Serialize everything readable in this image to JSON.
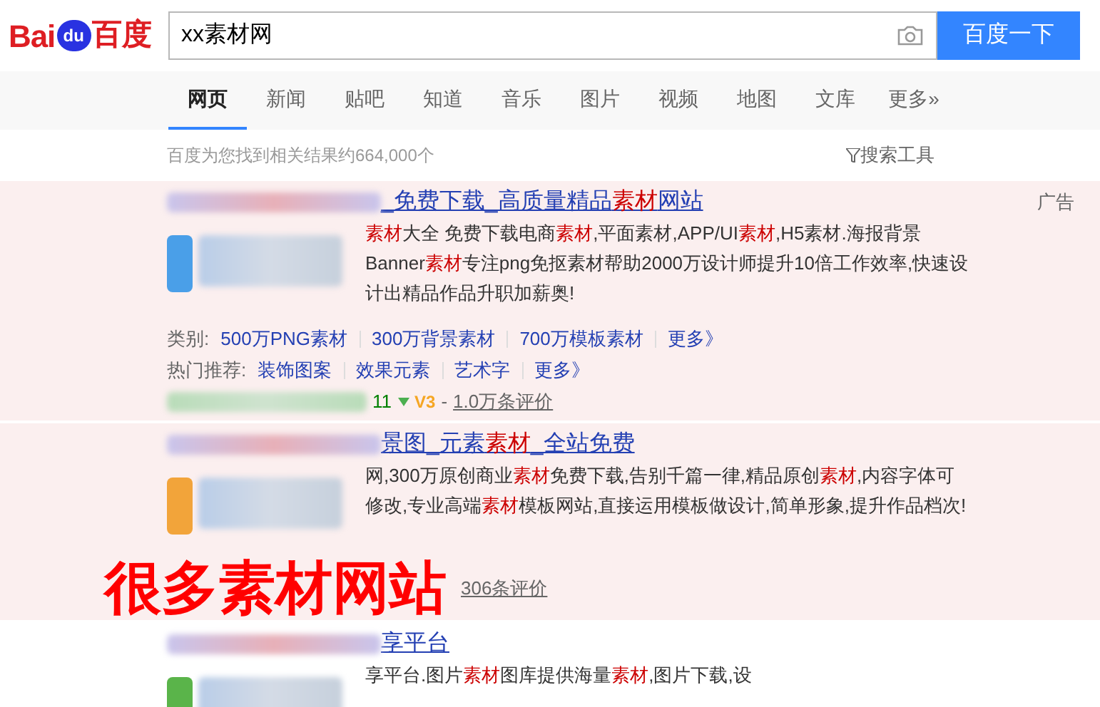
{
  "logo": {
    "part_1": "Bai",
    "part_2": "du",
    "part_3": "百度"
  },
  "search": {
    "value": "xx素材网",
    "button": "百度一下"
  },
  "tabs": [
    {
      "label": "网页",
      "selected": true
    },
    {
      "label": "新闻",
      "selected": false
    },
    {
      "label": "贴吧",
      "selected": false
    },
    {
      "label": "知道",
      "selected": false
    },
    {
      "label": "音乐",
      "selected": false
    },
    {
      "label": "图片",
      "selected": false
    },
    {
      "label": "视频",
      "selected": false
    },
    {
      "label": "地图",
      "selected": false
    },
    {
      "label": "文库",
      "selected": false
    },
    {
      "label": "更多»",
      "selected": false
    }
  ],
  "result_count": "百度为您找到相关结果约664,000个",
  "search_tools": "搜索工具",
  "results": [
    {
      "ad": true,
      "ad_label": "广告",
      "title": "_免费下载_高质量精品**素材**网站",
      "color": "#4a9fe8",
      "snippet": "**素材**大全 免费下载电商**素材**,平面素材,APP/UI**素材**,H5素材.海报背景Banner**素材**专注png免抠素材帮助2000万设计师提升10倍工作效率,快速设计出精品作品升职加薪奥!",
      "categories_label": "类别:",
      "categories": [
        "500万PNG素材",
        "300万背景素材",
        "700万模板素材",
        "更多》"
      ],
      "hot_label": "热门推荐:",
      "hot": [
        "装饰图案",
        "效果元素",
        "艺术字",
        "更多》"
      ],
      "url_tail": "11",
      "badge": "V3",
      "separator": "-",
      "reviews": "1.0万条评价"
    },
    {
      "ad": true,
      "title": "景图_元素**素材**_全站免费",
      "color": "#f2a43a",
      "snippet": "网,300万原创商业**素材**免费下载,告别千篇一律,精品原创**素材**,内容字体可修改,专业高端**素材**模板网站,直接运用模板做设计,简单形象,提升作品档次!",
      "reviews": "306条评价"
    },
    {
      "ad": false,
      "title": "享平台",
      "color": "#5ab44a",
      "snippet": "享平台.图片**素材**图库提供海量**素材**,图片下载,设"
    }
  ],
  "overlay_caption": "很多素材网站"
}
